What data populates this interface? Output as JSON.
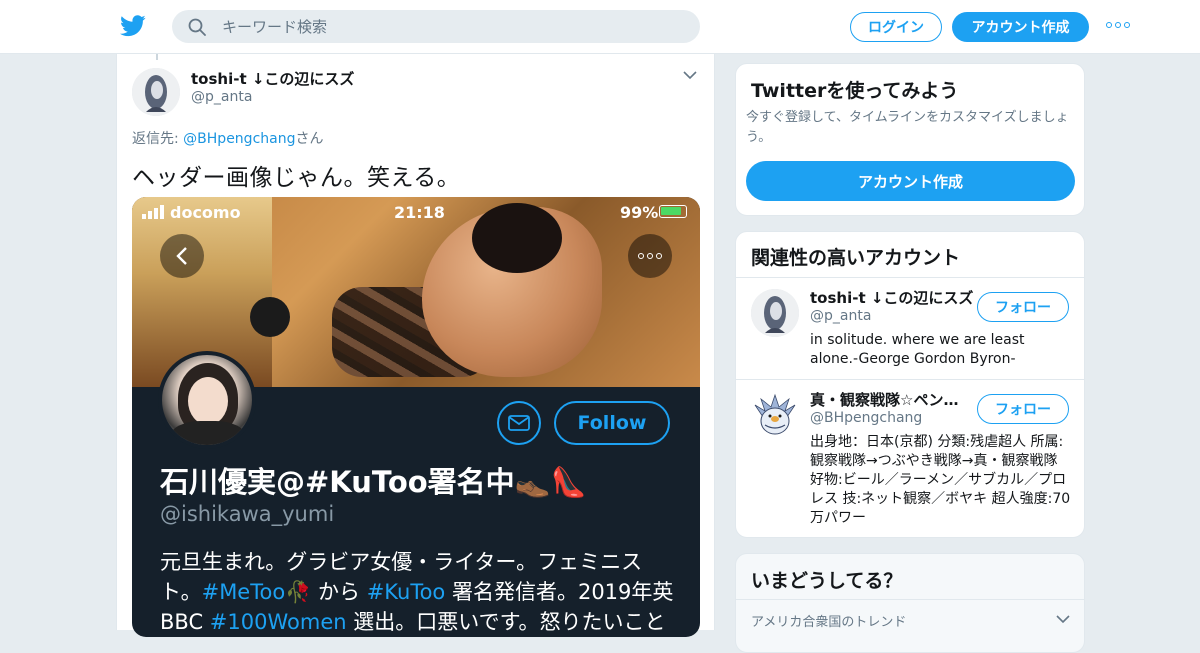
{
  "header": {
    "search_placeholder": "キーワード検索",
    "login_label": "ログイン",
    "signup_label": "アカウント作成"
  },
  "tweet": {
    "author_name": "toshi-t ↓この辺にスズ",
    "author_handle": "@p_anta",
    "reply_prefix": "返信先: ",
    "reply_to": "@BHpengchang",
    "reply_suffix": "さん",
    "text": "ヘッダー画像じゃん。笑える。",
    "media": {
      "carrier": "docomo",
      "time": "21:18",
      "battery": "99%",
      "follow_label": "Follow",
      "profile_name": "石川優実@#KuToo署名中👞👠",
      "profile_handle": "@ishikawa_yumi",
      "bio_line1": "元旦生まれ。グラビア女優・ライター。フェミニス",
      "bio_line2_a": "ト。",
      "bio_tag1": "#MeToo",
      "bio_line2_b": "🥀 から ",
      "bio_tag2": "#KuToo",
      "bio_line2_c": " 署名発信者。2019年英",
      "bio_line3_a": "BBC ",
      "bio_tag3": "#100Women",
      "bio_line3_b": " 選出。口悪いです。怒りたいことを"
    }
  },
  "sidebar": {
    "signup_card": {
      "title": "Twitterを使ってみよう",
      "description": "今すぐ登録して、タイムラインをカスタマイズしましょう。",
      "button": "アカウント作成"
    },
    "related": {
      "title": "関連性の高いアカウント",
      "accounts": [
        {
          "name": "toshi-t ↓この辺にスズ",
          "handle": "@p_anta",
          "bio": "in solitude. where we are least alone.-George Gordon Byron-",
          "follow_label": "フォロー"
        },
        {
          "name": "真・観察戦隊☆ペン…",
          "handle": "@BHpengchang",
          "bio": "出身地：日本(京都) 分類:残虐超人 所属:観察戦隊→つぶやき戦隊→真・観察戦隊 好物:ビール／ラーメン／サブカル／プロレス 技:ネット観察／ボヤキ 超人強度:70万パワー",
          "follow_label": "フォロー"
        }
      ]
    },
    "trends": {
      "title": "いまどうしてる？",
      "subtitle": "アメリカ合衆国のトレンド"
    }
  },
  "colors": {
    "accent": "#1da1f2",
    "background": "#e6ecf0",
    "media_bg": "#15202b"
  }
}
